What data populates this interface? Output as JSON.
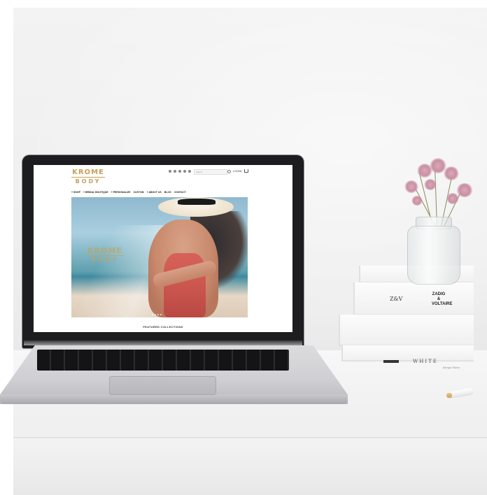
{
  "site": {
    "logo_line1": "KROME",
    "logo_line2": "BODY",
    "search_placeholder": "Search",
    "login_label": "LOGIN",
    "nav": [
      "+ SHOP",
      "+ BRIDAL BOUTIQUE",
      "+ PERSONALIZE",
      "CUSTOM",
      "+ ABOUT US",
      "BLOG",
      "CONTACT"
    ],
    "hero_logo_line1": "KROME",
    "hero_logo_line2": "BODY",
    "featured_heading": "FEATURED COLLECTIONS"
  },
  "books": {
    "brand_zv": "Z&V",
    "brand_zadig": "ZADIG & VOLTAIRE",
    "white_title": "WHITE",
    "white_author": "Kenya Hara"
  },
  "colors": {
    "logo_gold": "#c4a15a",
    "laptop_bezel": "#1d1d1f",
    "laptop_aluminum": "#cfcfd3",
    "dress_coral": "#c9544e",
    "flower_pink": "#c98fa2"
  },
  "icons": [
    "social-icon",
    "search-icon",
    "cart-icon"
  ]
}
